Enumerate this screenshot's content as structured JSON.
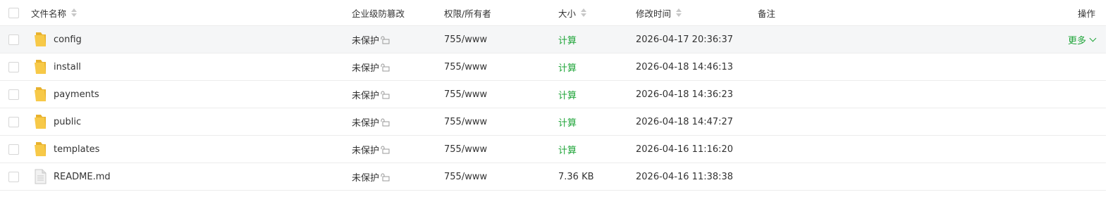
{
  "header": {
    "name": "文件名称",
    "protect": "企业级防篡改",
    "perm": "权限/所有者",
    "size": "大小",
    "mtime": "修改时间",
    "note": "备注",
    "ops": "操作"
  },
  "rows": [
    {
      "name": "config",
      "type": "folder",
      "protect": "未保护",
      "perm": "755/www",
      "size": "计算",
      "mtime": "2026-04-17 20:36:37",
      "more": "更多"
    },
    {
      "name": "install",
      "type": "folder",
      "protect": "未保护",
      "perm": "755/www",
      "size": "计算",
      "mtime": "2026-04-18 14:46:13"
    },
    {
      "name": "payments",
      "type": "folder",
      "protect": "未保护",
      "perm": "755/www",
      "size": "计算",
      "mtime": "2026-04-18 14:36:23"
    },
    {
      "name": "public",
      "type": "folder",
      "protect": "未保护",
      "perm": "755/www",
      "size": "计算",
      "mtime": "2026-04-18 14:47:27"
    },
    {
      "name": "templates",
      "type": "folder",
      "protect": "未保护",
      "perm": "755/www",
      "size": "计算",
      "mtime": "2026-04-16 11:16:20"
    },
    {
      "name": "README.md",
      "type": "file",
      "protect": "未保护",
      "perm": "755/www",
      "size": "7.36 KB",
      "mtime": "2026-04-16 11:38:38"
    }
  ],
  "colors": {
    "accent": "#20a53a",
    "folder": "#f7c948",
    "border": "#ececec",
    "hover_bg": "#f5f6f7"
  }
}
